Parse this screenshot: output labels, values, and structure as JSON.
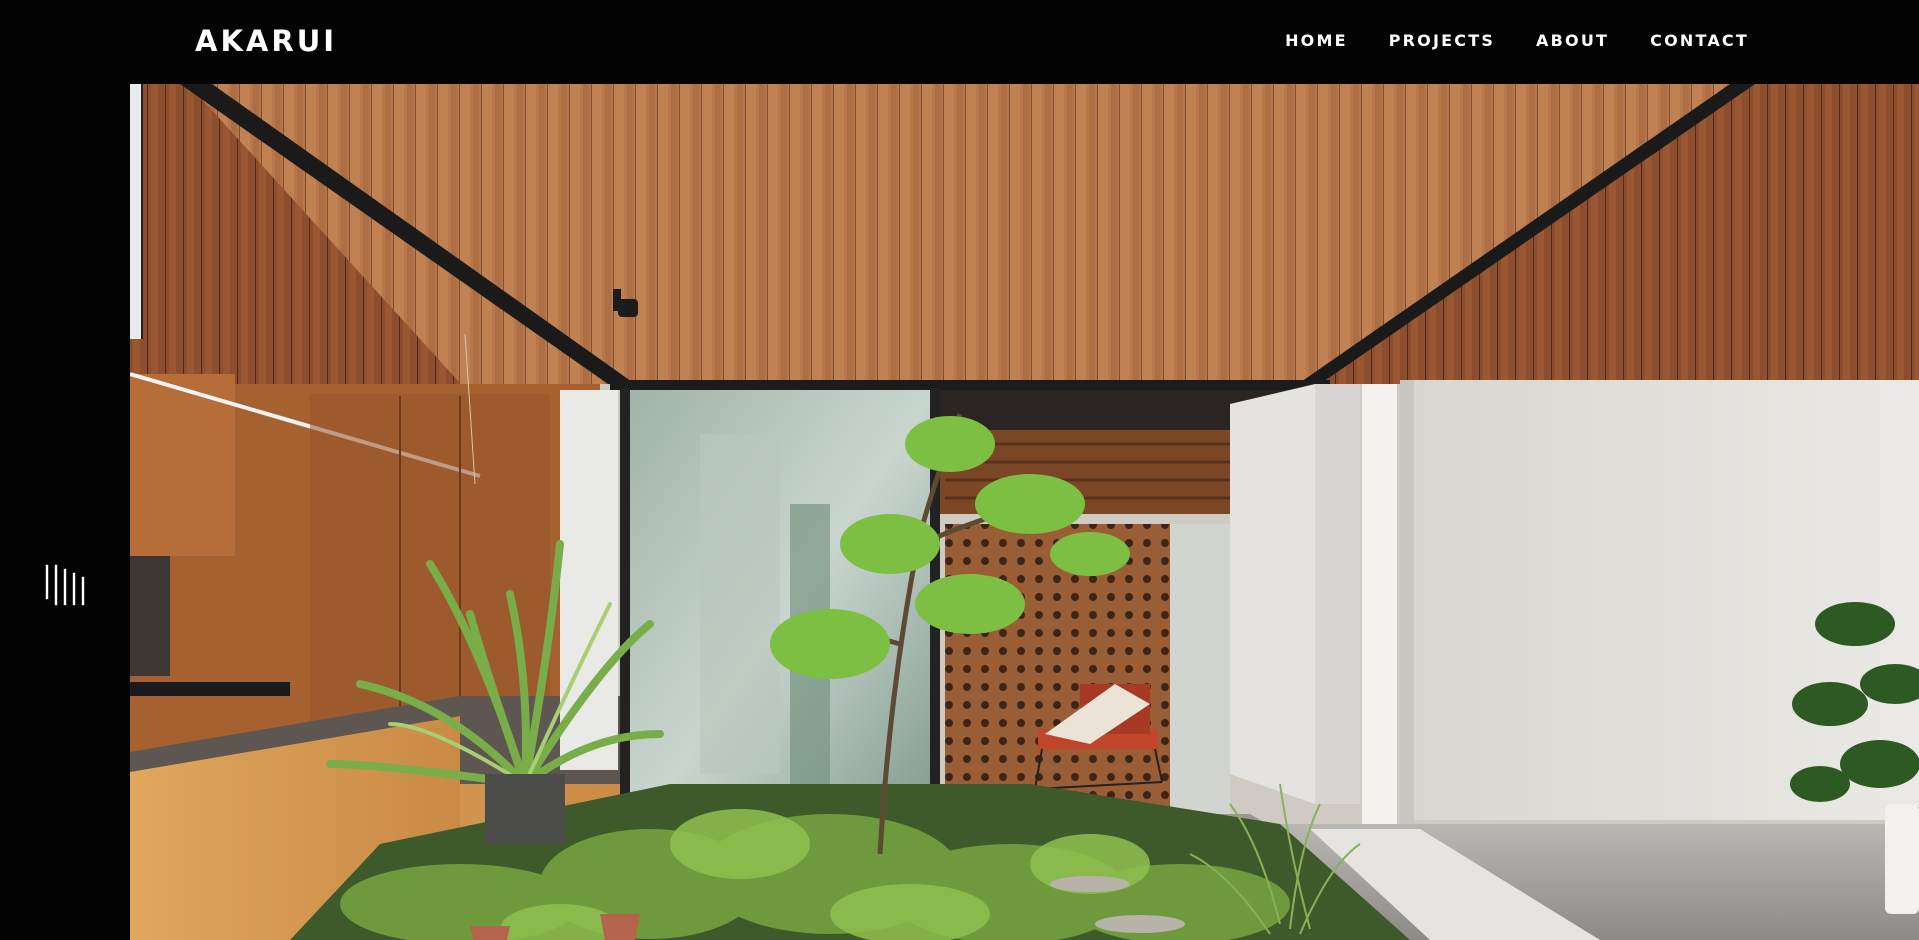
{
  "header": {
    "logo": "AKARUI",
    "nav": [
      {
        "label": "HOME"
      },
      {
        "label": "PROJECTS"
      },
      {
        "label": "ABOUT"
      },
      {
        "label": "CONTACT"
      }
    ]
  },
  "sidebar": {
    "menu_icon": "vertical-lines-menu-icon"
  },
  "hero": {
    "image_subject": "courtyard-garden-timber-house-photo"
  },
  "colors": {
    "background": "#030303",
    "text": "#ffffff",
    "timber": "#b7774a",
    "wall": "#e8e6e1",
    "foliage": "#5d8a3a"
  }
}
